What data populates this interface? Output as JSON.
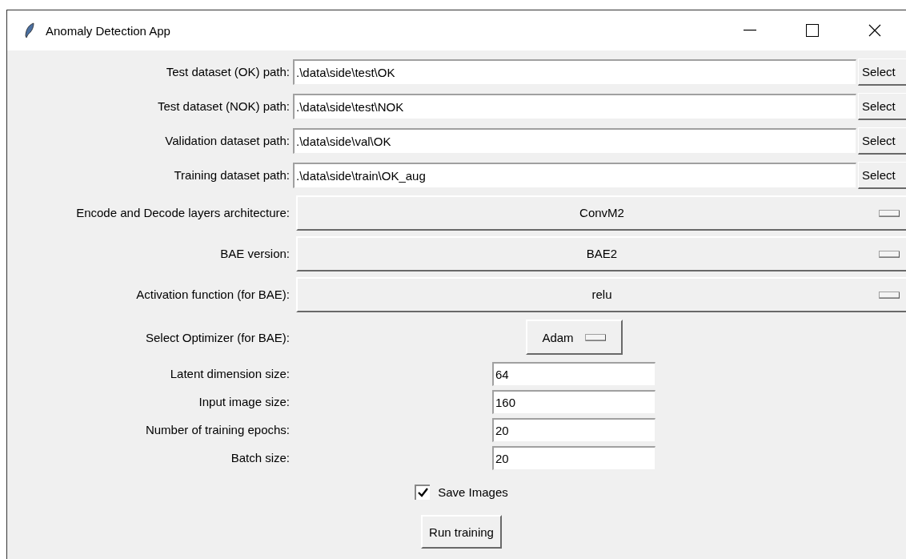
{
  "window": {
    "title": "Anomaly Detection App"
  },
  "paths": [
    {
      "label": "Test dataset (OK) path:",
      "value": ".\\data\\side\\test\\OK",
      "button": "Select"
    },
    {
      "label": "Test dataset (NOK) path:",
      "value": ".\\data\\side\\test\\NOK",
      "button": "Select"
    },
    {
      "label": "Validation dataset path:",
      "value": ".\\data\\side\\val\\OK",
      "button": "Select"
    },
    {
      "label": "Training dataset path:",
      "value": ".\\data\\side\\train\\OK_aug",
      "button": "Select"
    }
  ],
  "dropdowns": [
    {
      "label": "Encode and Decode layers architecture:",
      "value": "ConvM2"
    },
    {
      "label": "BAE version:",
      "value": "BAE2"
    },
    {
      "label": "Activation function (for BAE):",
      "value": "relu"
    }
  ],
  "optimizer": {
    "label": "Select Optimizer (for BAE):",
    "value": "Adam"
  },
  "params": [
    {
      "label": "Latent dimension size:",
      "value": "64"
    },
    {
      "label": "Input image size:",
      "value": "160"
    },
    {
      "label": "Number of training epochs:",
      "value": "20"
    },
    {
      "label": "Batch size:",
      "value": "20"
    }
  ],
  "save_images": {
    "label": "Save Images",
    "checked": true
  },
  "run_button": "Run training"
}
